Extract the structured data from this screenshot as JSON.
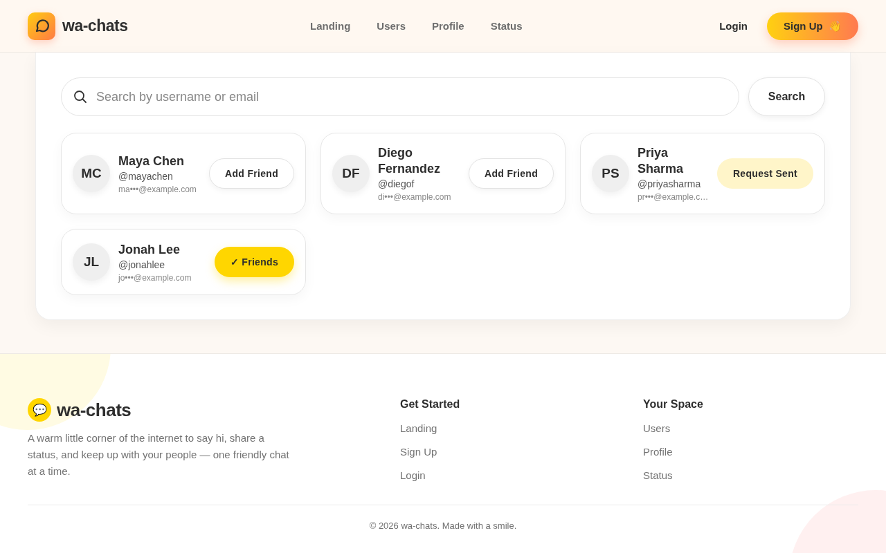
{
  "header": {
    "brand": "wa-chats",
    "nav": [
      {
        "label": "Landing"
      },
      {
        "label": "Users"
      },
      {
        "label": "Profile"
      },
      {
        "label": "Status"
      }
    ],
    "login": "Login",
    "signup": {
      "label": "Sign Up",
      "emoji": "👋"
    }
  },
  "search": {
    "placeholder": "Search by username or email",
    "button": "Search"
  },
  "users": [
    {
      "initials": "MC",
      "name": "Maya Chen",
      "handle": "@mayachen",
      "email": "ma•••@example.com",
      "action": {
        "kind": "add",
        "label": "Add Friend"
      }
    },
    {
      "initials": "DF",
      "name": "Diego Fernandez",
      "handle": "@diegof",
      "email": "di•••@example.com",
      "action": {
        "kind": "add",
        "label": "Add Friend"
      }
    },
    {
      "initials": "PS",
      "name": "Priya Sharma",
      "handle": "@priyasharma",
      "email": "pr•••@example.c…",
      "action": {
        "kind": "sent",
        "label": "Request Sent"
      }
    },
    {
      "initials": "JL",
      "name": "Jonah Lee",
      "handle": "@jonahlee",
      "email": "jo•••@example.com",
      "action": {
        "kind": "friends",
        "label": "✓ Friends"
      }
    }
  ],
  "footer": {
    "brand": "wa-chats",
    "emoji": "💬",
    "tagline": "A warm little corner of the internet to say hi, share a status, and keep up with your people — one friendly chat at a time.",
    "columns": [
      {
        "title": "Get Started",
        "links": [
          "Landing",
          "Sign Up",
          "Login"
        ]
      },
      {
        "title": "Your Space",
        "links": [
          "Users",
          "Profile",
          "Status"
        ]
      }
    ],
    "copyright": "© 2026 wa-chats. Made with a smile."
  }
}
